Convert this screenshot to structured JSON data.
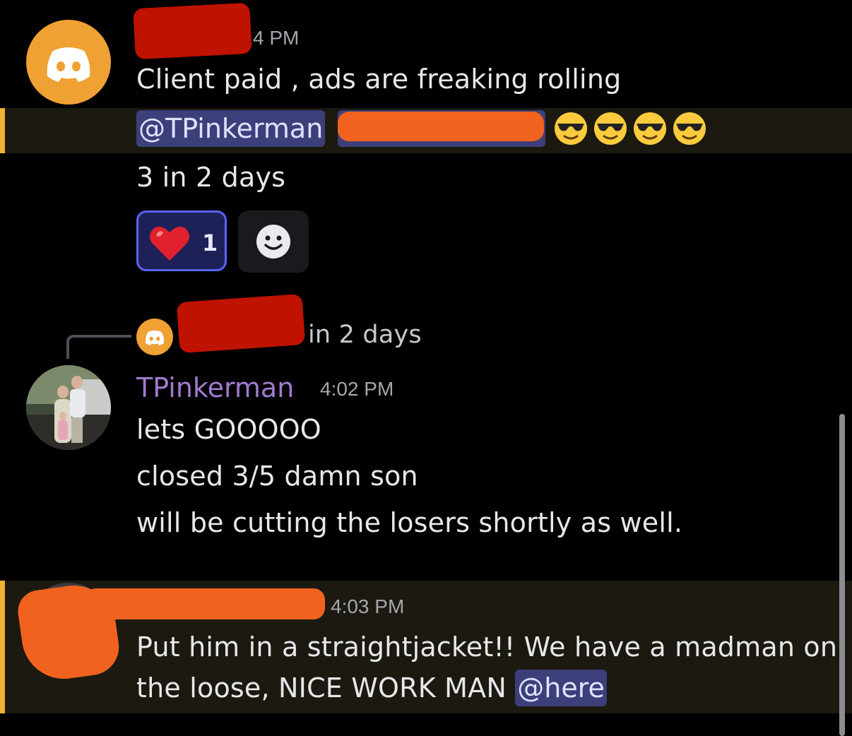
{
  "messages": [
    {
      "time_partial": "4 PM",
      "lines": [
        "Client paid , ads are freaking rolling"
      ],
      "mention": "@TPinkerman",
      "emoji": [
        "sunglasses-emoji",
        "sunglasses-emoji",
        "sunglasses-emoji",
        "sunglasses-emoji"
      ],
      "line3": "3 in 2 days",
      "reaction": {
        "emoji": "heart-emoji",
        "count": "1"
      }
    },
    {
      "reply_preview": "in 2 days",
      "username": "TPinkerman",
      "time": "4:02 PM",
      "lines": [
        "lets GOOOOO",
        "closed 3/5 damn son",
        "will be cutting the losers shortly as well."
      ]
    },
    {
      "time": "4:03 PM",
      "line1": "Put him in a straightjacket!! We have a madman on",
      "line2_prefix": "the loose, NICE WORK MAN ",
      "mention": "@here"
    }
  ],
  "colors": {
    "background": "#000000",
    "mention_highlight": "#1b1910",
    "mention_accent": "#f0b232",
    "username": "#a07bd0",
    "mention_pill": "#3c3f79"
  }
}
